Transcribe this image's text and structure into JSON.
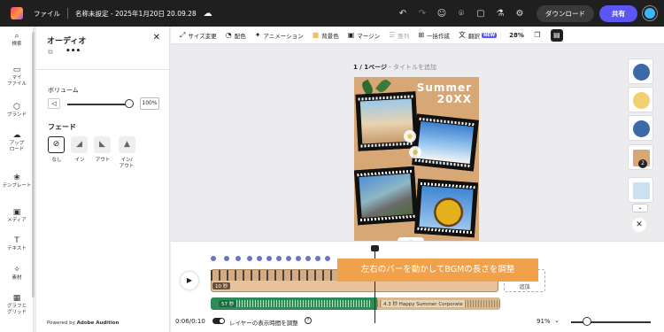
{
  "topbar": {
    "file_menu": "ファイル",
    "doc_title": "名称未設定 - 2025年1月20日 20.09.28",
    "download": "ダウンロード",
    "share": "共有",
    "icons": [
      "undo-icon",
      "redo-icon",
      "user-add-icon",
      "location-icon",
      "comment-icon",
      "lab-icon",
      "settings-icon"
    ]
  },
  "sidebar": {
    "items": [
      {
        "label": "検索",
        "icon": "search-icon"
      },
      {
        "label": "マイ\nファイル",
        "icon": "folder-icon"
      },
      {
        "label": "ブランド",
        "icon": "brand-icon"
      },
      {
        "label": "アップ\nロード",
        "icon": "upload-icon"
      },
      {
        "label": "テンプレート",
        "icon": "template-icon"
      },
      {
        "label": "メディア",
        "icon": "media-icon"
      },
      {
        "label": "テキスト",
        "icon": "text-icon"
      },
      {
        "label": "素材",
        "icon": "elements-icon"
      },
      {
        "label": "グラフと\nグリッド",
        "icon": "grid-icon"
      }
    ]
  },
  "panel": {
    "title": "オーディオ",
    "more": "•••",
    "volume_label": "ボリューム",
    "volume_value": "100%",
    "volume_level": 1.0,
    "fade_label": "フェード",
    "fade_options": [
      "なし",
      "イン",
      "アウト",
      "イン/\nアウト"
    ],
    "fade_selected": 0,
    "powered_prefix": "Powered by",
    "powered_brand": "Adobe Audition"
  },
  "context_toolbar": {
    "items": [
      "サイズ変更",
      "配色",
      "アニメーション",
      "背景色",
      "マージン",
      "整列",
      "一括作成",
      "翻訳"
    ],
    "new_badge": "NEW",
    "zoom": "28%"
  },
  "canvas": {
    "page_indicator": "1 / 1ページ",
    "add_title": "- タイトルを追加",
    "poster_title_line1": "Summer",
    "poster_title_line2": "20XX"
  },
  "right_rail": {
    "thumb_badge": "2"
  },
  "timeline": {
    "video_track_label": "10 秒",
    "add_label": "追加",
    "audio_left_label": "57 秒",
    "audio_right_label": "4.3 秒 Happy Summer Corporate",
    "tooltip": "左右のバーを動かしてBGMの長さを調整",
    "time_readout": "0:06/0:10",
    "layer_toggle_label": "レイヤーの表示時間を調整",
    "zoom": "91%"
  }
}
